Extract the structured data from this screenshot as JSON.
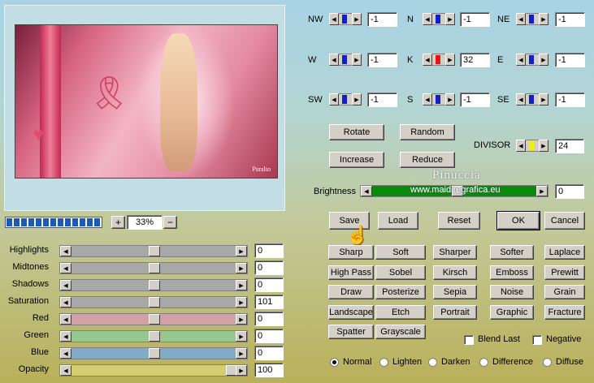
{
  "preview": {
    "credit": "Paralto"
  },
  "zoom": {
    "value": "33%",
    "plus": "+",
    "minus": "−",
    "progress_pct": 100
  },
  "matrix": [
    {
      "label": "NW",
      "value": "-1",
      "thumb_color": "#1020c8"
    },
    {
      "label": "N",
      "value": "-1",
      "thumb_color": "#1020c8"
    },
    {
      "label": "NE",
      "value": "-1",
      "thumb_color": "#1020c8"
    },
    {
      "label": "W",
      "value": "-1",
      "thumb_color": "#1020c8"
    },
    {
      "label": "K",
      "value": "32",
      "thumb_color": "#e01818"
    },
    {
      "label": "E",
      "value": "-1",
      "thumb_color": "#1020c8"
    },
    {
      "label": "SW",
      "value": "-1",
      "thumb_color": "#1020c8"
    },
    {
      "label": "S",
      "value": "-1",
      "thumb_color": "#1020c8"
    },
    {
      "label": "SE",
      "value": "-1",
      "thumb_color": "#1020c8"
    }
  ],
  "buttons": {
    "rotate": "Rotate",
    "random": "Random",
    "increase": "Increase",
    "reduce": "Reduce",
    "save": "Save",
    "load": "Load",
    "reset": "Reset",
    "ok": "OK",
    "cancel": "Cancel"
  },
  "divisor": {
    "label": "DIVISOR",
    "value": "24",
    "thumb_color": "#f0f000"
  },
  "brightness": {
    "label": "Brightness",
    "value": "0",
    "track_color": "#0a8a0a"
  },
  "adjustments": [
    {
      "label": "Highlights",
      "value": "0",
      "track_color": "#a8a8a8",
      "level": 0.5
    },
    {
      "label": "Midtones",
      "value": "0",
      "track_color": "#a8a8a8",
      "level": 0.5
    },
    {
      "label": "Shadows",
      "value": "0",
      "track_color": "#a8a8a8",
      "level": 0.5
    },
    {
      "label": "Saturation",
      "value": "101",
      "track_color": "#a8a8a8",
      "level": 0.5
    },
    {
      "label": "Red",
      "value": "0",
      "track_color": "#d4a0a8",
      "level": 0.5
    },
    {
      "label": "Green",
      "value": "0",
      "track_color": "#98c890",
      "level": 0.5
    },
    {
      "label": "Blue",
      "value": "0",
      "track_color": "#80acc8",
      "level": 0.5
    },
    {
      "label": "Opacity",
      "value": "100",
      "track_color": "#d4cc70",
      "level": 1.0
    }
  ],
  "presets": [
    "Sharp",
    "Soft",
    "Sharper",
    "Softer",
    "Laplace",
    "High Pass",
    "Sobel",
    "Kirsch",
    "Emboss",
    "Prewitt",
    "Draw",
    "Posterize",
    "Sepia",
    "Noise",
    "Grain",
    "Landscape",
    "Etch",
    "Portrait",
    "Graphic",
    "Fracture",
    "Spatter",
    "Grayscale"
  ],
  "checkboxes": [
    {
      "label": "Blend Last",
      "checked": false
    },
    {
      "label": "Negative",
      "checked": false
    }
  ],
  "blend_modes": [
    {
      "label": "Normal",
      "selected": true
    },
    {
      "label": "Lighten",
      "selected": false
    },
    {
      "label": "Darken",
      "selected": false
    },
    {
      "label": "Difference",
      "selected": false
    },
    {
      "label": "Diffuse",
      "selected": false
    }
  ],
  "watermark": {
    "line1": "Pinuccia",
    "line2": "www.maidiregrafica.eu"
  }
}
